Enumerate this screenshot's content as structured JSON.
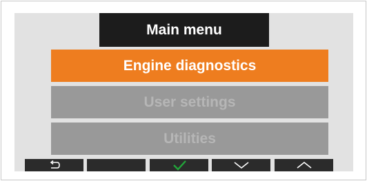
{
  "header": {
    "title": "Main menu"
  },
  "menu": {
    "items": [
      {
        "label": "Engine diagnostics",
        "selected": true
      },
      {
        "label": "User settings",
        "selected": false
      },
      {
        "label": "Utilities",
        "selected": false
      }
    ]
  },
  "softkeys": [
    {
      "icon": "back-arrow-icon"
    },
    {
      "icon": "none"
    },
    {
      "icon": "checkmark-icon"
    },
    {
      "icon": "chevron-down-icon"
    },
    {
      "icon": "chevron-up-icon"
    }
  ],
  "colors": {
    "accent": "#ee7d1f",
    "checkmark": "#22a53a",
    "title_background": "#1c1c1c",
    "inactive_item_background": "#999999",
    "screen_background": "#e2e2e2"
  }
}
